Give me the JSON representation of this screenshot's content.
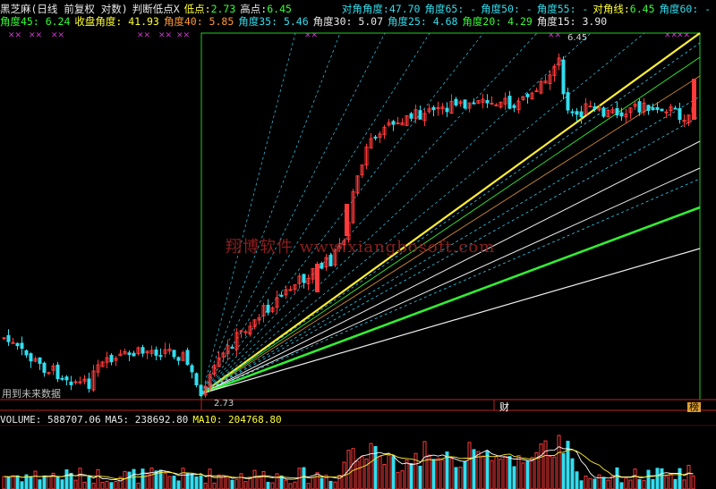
{
  "header": {
    "title": "黑芝麻(日线 前复权 对数)",
    "indicator": "判断低点X",
    "low_label": "低点:",
    "low_value": "2.73",
    "high_label": "高点:",
    "high_value": "6.45",
    "diag_angle_label": "对角角度:",
    "diag_angle_value": "47.70",
    "a65": "角度65: -",
    "a50": "角度50: -",
    "a55": "角度55: -",
    "diag_line_label": "对角线:",
    "diag_line_value": "6.45",
    "a60": "角度60: -",
    "a45": "角度45: 6.24",
    "close_angle": "收盘角度: 41.93",
    "a40": "角度40: 5.85",
    "a35": "角度35: 5.46",
    "a30": "角度30: 5.07",
    "a25": "角度25: 4.68",
    "a20": "角度20: 4.29",
    "a15": "角度15: 3.90"
  },
  "chart": {
    "future_label": "用到未来数据",
    "low_point_label": "2.73",
    "high_point_label": "6.45",
    "watermark": "翔博软件 www.xiangbosoft.com",
    "tag_cai": "财",
    "tag_bang": "榜",
    "up_color": "#ff3a3a",
    "down_color": "#33ddee",
    "ray_white": "#f0f0f0",
    "ray_green": "#33ee33",
    "ray_yellow": "#ffee33",
    "ray_cyan": "#33ccee",
    "ray_orange": "#cc8833",
    "box_border": "#22cc22"
  },
  "volume": {
    "label": "VOLUME: 588707.06",
    "ma5": "MA5: 238692.80",
    "ma10": "MA10: 204768.80",
    "ma5_color": "#ffffff",
    "ma10_color": "#ffee33"
  }
}
